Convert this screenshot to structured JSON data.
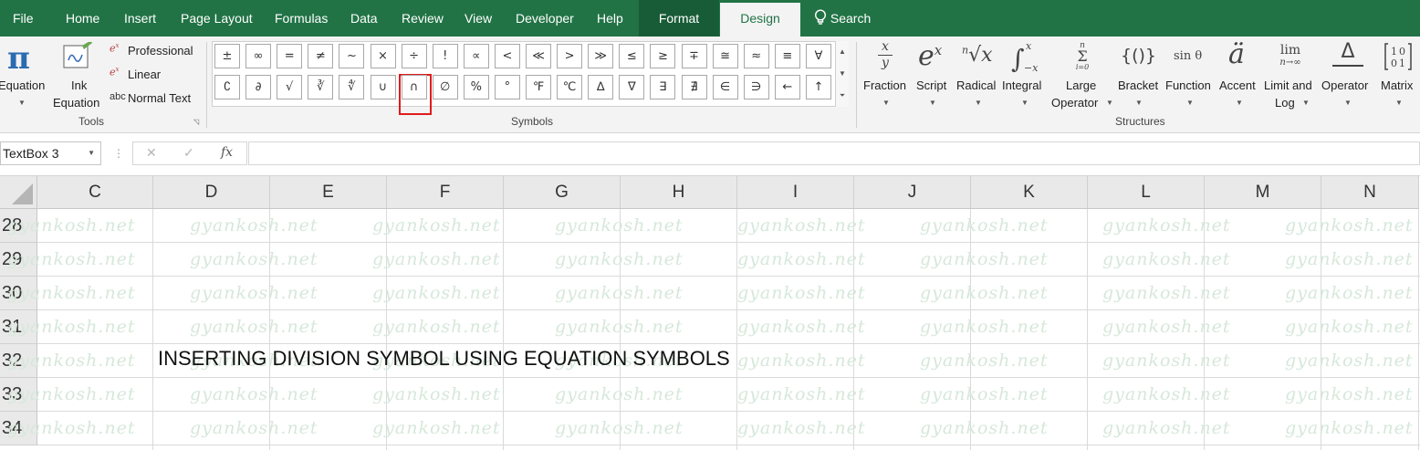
{
  "tabs": {
    "file": "File",
    "home": "Home",
    "insert": "Insert",
    "page_layout": "Page Layout",
    "formulas": "Formulas",
    "data": "Data",
    "review": "Review",
    "view": "View",
    "developer": "Developer",
    "help": "Help",
    "format": "Format",
    "design": "Design",
    "search": "Search"
  },
  "ribbon": {
    "tools": {
      "equation_label": "Equation",
      "ink_label_1": "Ink",
      "ink_label_2": "Equation",
      "professional": "Professional",
      "linear": "Linear",
      "normal_text": "Normal Text",
      "abc_glyph": "abc",
      "group_label": "Tools"
    },
    "symbols": {
      "row1": [
        "±",
        "∞",
        "=",
        "≠",
        "~",
        "×",
        "÷",
        "!",
        "∝",
        "<",
        "≪",
        ">",
        "≫",
        "≤",
        "≥",
        "∓",
        "≅",
        "≈",
        "≡",
        "∀"
      ],
      "row2": [
        "∁",
        "∂",
        "√",
        "∛",
        "∜",
        "∪",
        "∩",
        "∅",
        "%",
        "°",
        "℉",
        "℃",
        "∆",
        "∇",
        "∃",
        "∄",
        "∈",
        "∋",
        "←",
        "↑"
      ],
      "selected_symbol": "÷",
      "group_label": "Symbols"
    },
    "structures": {
      "items": [
        {
          "label": "Fraction",
          "icon": "fraction-icon"
        },
        {
          "label": "Script",
          "icon": "script-icon"
        },
        {
          "label": "Radical",
          "icon": "radical-icon"
        },
        {
          "label": "Integral",
          "icon": "integral-icon"
        },
        {
          "label": "Large",
          "label2": "Operator",
          "icon": "large-operator-icon"
        },
        {
          "label": "Bracket",
          "icon": "bracket-icon"
        },
        {
          "label": "Function",
          "icon": "function-icon"
        },
        {
          "label": "Accent",
          "icon": "accent-icon"
        },
        {
          "label": "Limit and",
          "label2": "Log",
          "icon": "limit-icon"
        },
        {
          "label": "Operator",
          "icon": "operator-icon"
        },
        {
          "label": "Matrix",
          "icon": "matrix-icon"
        }
      ],
      "icon_text": {
        "script_base": "e",
        "script_sup": "x",
        "radical_index": "n",
        "radical_sign": "√",
        "radical_base": "x",
        "integral_sign": "∫",
        "integral_upper": "x",
        "integral_lower": "−x",
        "large_op_upper": "n",
        "large_op_sign": "Σ",
        "large_op_lower": "i=0",
        "bracket": "{()}",
        "function": "sin θ",
        "accent": "ä",
        "limit_top": "lim",
        "limit_bottom": "n→∞",
        "operator": "Δ",
        "matrix": "[1 0 / 0 1]",
        "fraction_num": "x",
        "fraction_den": "y"
      },
      "group_label": "Structures"
    }
  },
  "formula_bar": {
    "name_box": "TextBox 3",
    "cancel": "✕",
    "enter": "✓",
    "fx": "fx",
    "value": ""
  },
  "grid": {
    "columns": [
      "C",
      "D",
      "E",
      "F",
      "G",
      "H",
      "I",
      "J",
      "K",
      "L",
      "M",
      "N"
    ],
    "rows": [
      "28",
      "29",
      "30",
      "31",
      "32",
      "33",
      "34"
    ],
    "watermark": "gyankosh.net",
    "cell_D32": "INSERTING DIVISION SYMBOL USING EQUATION SYMBOLS"
  },
  "colors": {
    "excel_green": "#217346",
    "highlight_red": "#e01b1b"
  }
}
